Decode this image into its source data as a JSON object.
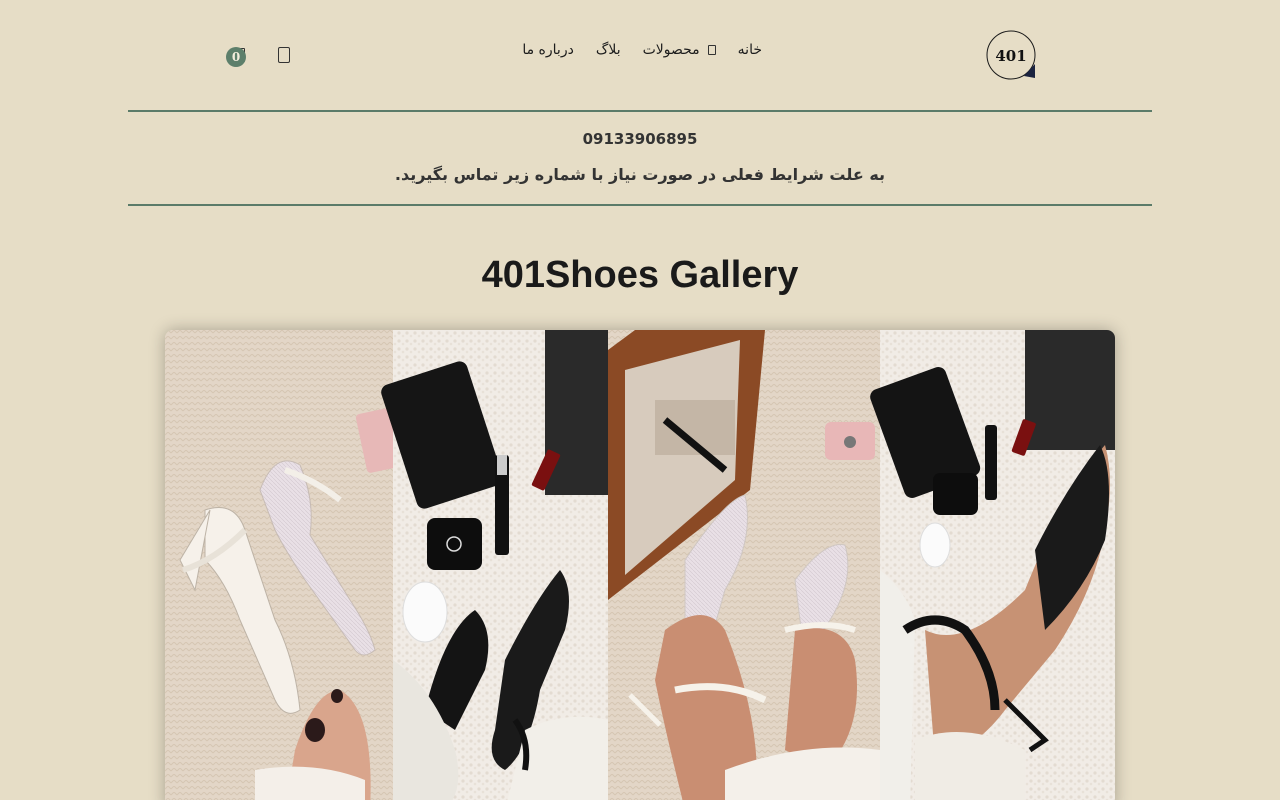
{
  "header": {
    "logo_text": "401",
    "nav": [
      {
        "label": "خانه"
      },
      {
        "label": "محصولات",
        "has_dropdown": true
      },
      {
        "label": "بلاگ"
      },
      {
        "label": "درباره ما"
      }
    ],
    "cart_count": "0"
  },
  "notice": {
    "phone": "09133906895",
    "message": "به علت شرایط فعلی در صورت نیاز با شماره زیر تماس بگیرید."
  },
  "gallery": {
    "title": "401Shoes Gallery"
  },
  "colors": {
    "background": "#e6ddc6",
    "accent": "#5b7b69",
    "badge": "#5d7f6b"
  }
}
